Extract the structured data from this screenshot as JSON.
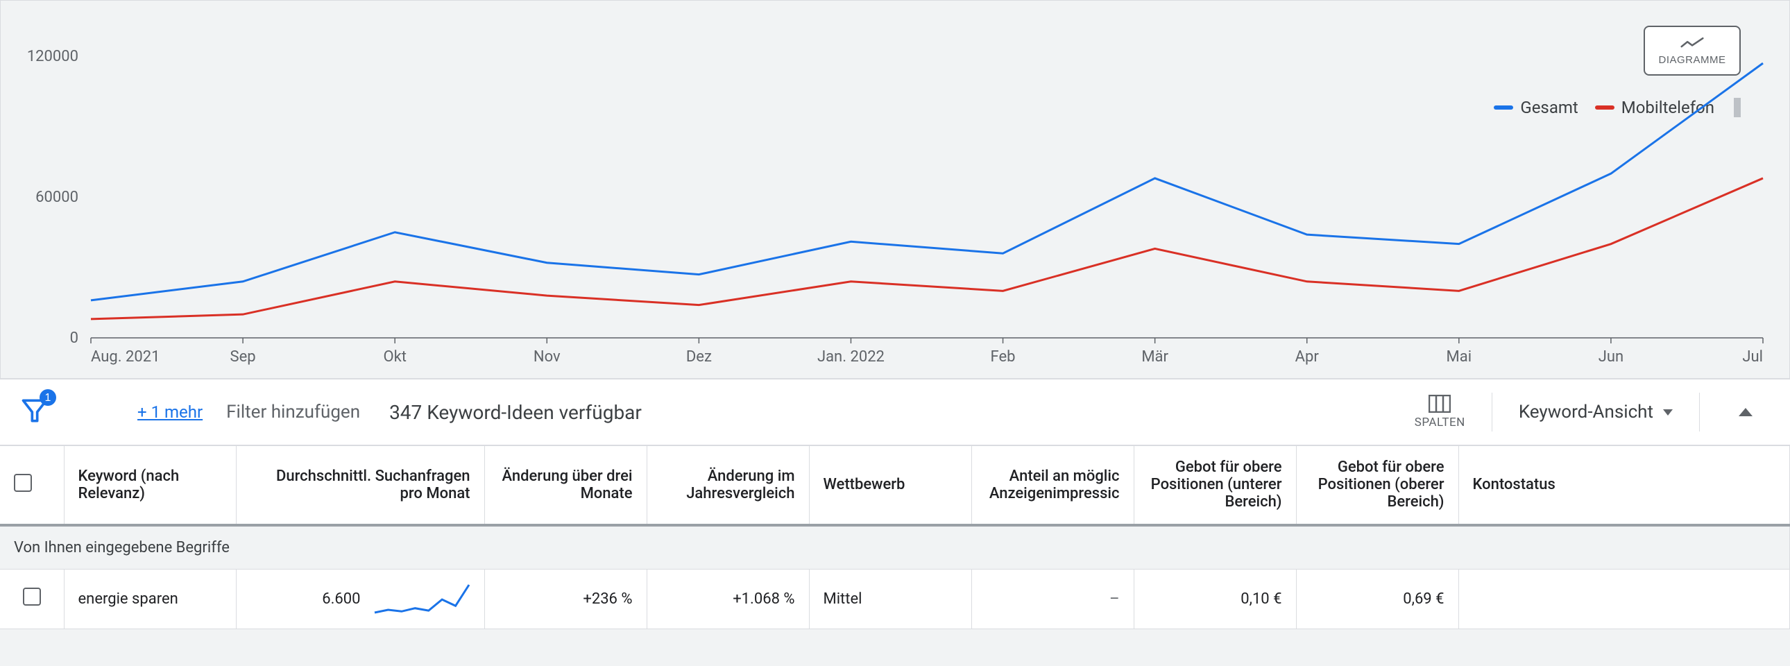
{
  "chart": {
    "diagram_btn_label": "DIAGRAMME"
  },
  "legend": {
    "seriesA": "Gesamt",
    "seriesB": "Mobiltelefon"
  },
  "filter": {
    "plus_one": "+ 1 mehr",
    "add_filter": "Filter hinzufügen",
    "available": "347 Keyword-Ideen verfügbar",
    "columns_btn": "SPALTEN",
    "view_btn": "Keyword-Ansicht"
  },
  "table": {
    "headers": {
      "keyword": "Keyword (nach Relevanz)",
      "avg": "Durchschnittl. Suchanfragen pro Monat",
      "chg3m": "Änderung über drei Monate",
      "chgYoY": "Änderung im Jahresvergleich",
      "competition": "Wettbewerb",
      "imprShare": "Anteil an möglic Anzeigenimpressic",
      "bidLow": "Gebot für obere Positionen (unterer Bereich)",
      "bidHigh": "Gebot für obere Positionen (oberer Bereich)",
      "status": "Kontostatus"
    },
    "section_label": "Von Ihnen eingegebene Begriffe",
    "rows": [
      {
        "keyword": "energie sparen",
        "avg": "6.600",
        "chg3m": "+236 %",
        "chgYoY": "+1.068 %",
        "competition": "Mittel",
        "imprShare": "–",
        "bidLow": "0,10 €",
        "bidHigh": "0,69 €",
        "status": ""
      }
    ]
  },
  "chart_data": {
    "type": "line",
    "xlabel": "",
    "ylabel": "",
    "ylim": [
      0,
      120000
    ],
    "yticks": [
      0,
      60000,
      120000
    ],
    "categories": [
      "Aug. 2021",
      "Sep",
      "Okt",
      "Nov",
      "Dez",
      "Jan. 2022",
      "Feb",
      "Mär",
      "Apr",
      "Mai",
      "Jun",
      "Jul"
    ],
    "series": [
      {
        "name": "Gesamt",
        "color": "#1a73e8",
        "values": [
          16000,
          24000,
          45000,
          32000,
          27000,
          41000,
          36000,
          68000,
          44000,
          40000,
          70000,
          117000
        ]
      },
      {
        "name": "Mobiltelefon",
        "color": "#d93025",
        "values": [
          8000,
          10000,
          24000,
          18000,
          14000,
          24000,
          20000,
          38000,
          24000,
          20000,
          40000,
          68000
        ]
      }
    ],
    "sparkline_row0": [
      25,
      32,
      28,
      36,
      30,
      58,
      42,
      95
    ]
  }
}
